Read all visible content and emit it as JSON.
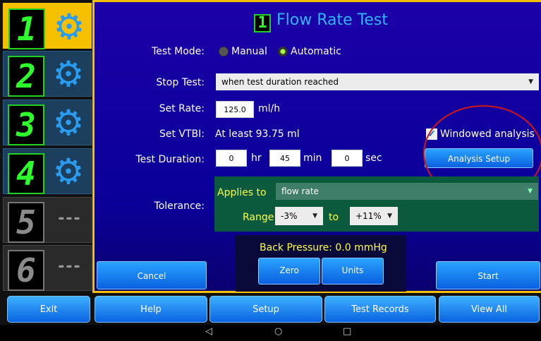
{
  "sidebar": {
    "channels": [
      {
        "digit": "1",
        "icon": "gear-icon",
        "state": "selected"
      },
      {
        "digit": "2",
        "icon": "gear-icon",
        "state": "active"
      },
      {
        "digit": "3",
        "icon": "gear-icon",
        "state": "active"
      },
      {
        "digit": "4",
        "icon": "gear-icon",
        "state": "active"
      },
      {
        "digit": "5",
        "icon": "dash",
        "dash": "---",
        "state": "inactive"
      },
      {
        "digit": "6",
        "icon": "dash",
        "dash": "---",
        "state": "inactive"
      }
    ]
  },
  "header": {
    "channel_digit": "1",
    "title": "Flow Rate Test"
  },
  "test_mode": {
    "label": "Test Mode:",
    "options": [
      "Manual",
      "Automatic"
    ],
    "selected": "Automatic"
  },
  "stop_test": {
    "label": "Stop Test:",
    "value": "when test duration reached"
  },
  "set_rate": {
    "label": "Set Rate:",
    "value": "125.0",
    "unit": "ml/h"
  },
  "set_vtbi": {
    "label": "Set VTBI:",
    "value": "At least 93.75 ml"
  },
  "windowed_analysis": {
    "label": "Windowed analysis",
    "checked": true
  },
  "analysis_setup_label": "Analysis Setup",
  "duration": {
    "label": "Test Duration:",
    "hr": "0",
    "hr_unit": "hr",
    "min": "45",
    "min_unit": "min",
    "sec": "0",
    "sec_unit": "sec"
  },
  "tolerance": {
    "label": "Tolerance:",
    "applies_to_label": "Applies to",
    "applies_to_value": "flow rate",
    "range_label": "Range",
    "low": "-3%",
    "to_label": "to",
    "high": "+11%"
  },
  "back_pressure": {
    "text": "Back Pressure: 0.0 mmHg",
    "zero_label": "Zero",
    "units_label": "Units"
  },
  "buttons": {
    "cancel": "Cancel",
    "start": "Start"
  },
  "bottom": {
    "exit": "Exit",
    "help": "Help",
    "setup": "Setup",
    "records": "Test Records",
    "view_all": "View All"
  },
  "nav": {
    "back": "◁",
    "home": "○",
    "recents": "□"
  },
  "colors": {
    "accent_yellow": "#f5c000",
    "title_blue": "#2fb6ff",
    "digit_green": "#2cff2c",
    "highlight_red": "#d21414"
  }
}
